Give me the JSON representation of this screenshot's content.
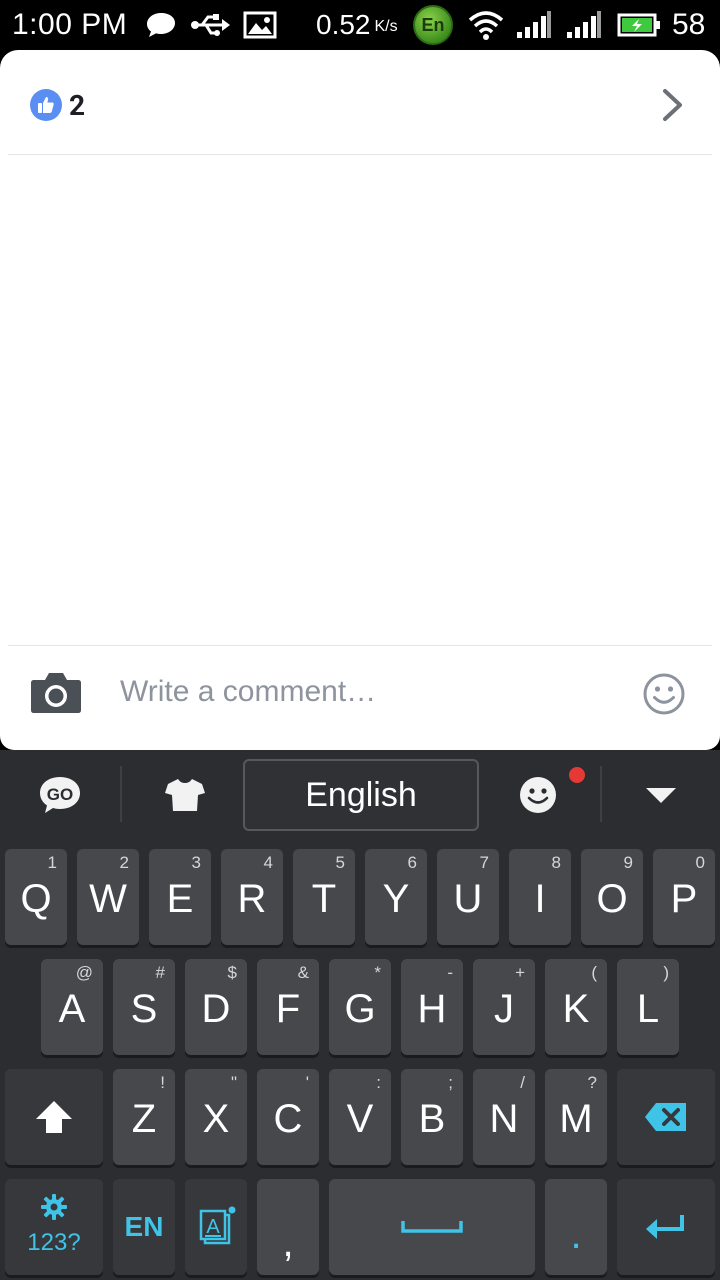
{
  "status_bar": {
    "time": "1:00 PM",
    "speed_value": "0.52",
    "speed_unit": "K/s",
    "en_badge": "En",
    "battery_percent": "58",
    "icons": [
      "chat-bubble-icon",
      "usb-icon",
      "image-icon",
      "en-badge-icon",
      "wifi-icon",
      "signal-icon",
      "signal-icon",
      "battery-charging-icon"
    ]
  },
  "post": {
    "like_count": "2",
    "chevron_icon": "chevron-right-icon"
  },
  "composer": {
    "placeholder": "Write a comment…",
    "value": ""
  },
  "keyboard": {
    "language_label": "English",
    "toolbar_icons": [
      "go-logo-icon",
      "theme-shirt-icon",
      "emoji-face-icon",
      "collapse-triangle-icon"
    ],
    "rows": [
      [
        {
          "label": "Q",
          "hint": "1"
        },
        {
          "label": "W",
          "hint": "2"
        },
        {
          "label": "E",
          "hint": "3"
        },
        {
          "label": "R",
          "hint": "4"
        },
        {
          "label": "T",
          "hint": "5"
        },
        {
          "label": "Y",
          "hint": "6"
        },
        {
          "label": "U",
          "hint": "7"
        },
        {
          "label": "I",
          "hint": "8"
        },
        {
          "label": "O",
          "hint": "9"
        },
        {
          "label": "P",
          "hint": "0"
        }
      ],
      [
        {
          "label": "A",
          "hint": "@"
        },
        {
          "label": "S",
          "hint": "#"
        },
        {
          "label": "D",
          "hint": "$"
        },
        {
          "label": "F",
          "hint": "&"
        },
        {
          "label": "G",
          "hint": "*"
        },
        {
          "label": "H",
          "hint": "-"
        },
        {
          "label": "J",
          "hint": "+"
        },
        {
          "label": "K",
          "hint": "("
        },
        {
          "label": "L",
          "hint": ")"
        }
      ],
      [
        {
          "label": "Z",
          "hint": "!"
        },
        {
          "label": "X",
          "hint": "\""
        },
        {
          "label": "C",
          "hint": "'"
        },
        {
          "label": "V",
          "hint": ":"
        },
        {
          "label": "B",
          "hint": ";"
        },
        {
          "label": "N",
          "hint": "/"
        },
        {
          "label": "M",
          "hint": "?"
        }
      ]
    ],
    "symbols_label": "123?",
    "lang_key_label": "EN",
    "comma_label": ",",
    "period_label": ".",
    "accent_color": "#3fc4e8"
  }
}
